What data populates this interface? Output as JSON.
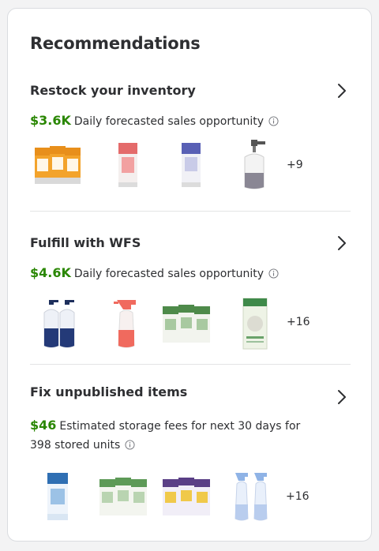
{
  "card": {
    "title": "Recommendations"
  },
  "sections": [
    {
      "title": "Restock your inventory",
      "amount": "$3.6K",
      "description": "Daily forecasted sales opportunity",
      "more": "+9"
    },
    {
      "title": "Fulfill with WFS",
      "amount": "$4.6K",
      "description": "Daily forecasted sales opportunity",
      "more": "+16"
    },
    {
      "title": "Fix unpublished items",
      "amount": "$46",
      "description": "Estimated storage fees for next 30 days for 398 stored units",
      "more": "+16"
    }
  ],
  "colors": {
    "accent_green": "#2a8703",
    "text": "#2e2f32",
    "divider": "#e3e4e5"
  },
  "icons": [
    "chevron-right-icon",
    "info-icon"
  ]
}
